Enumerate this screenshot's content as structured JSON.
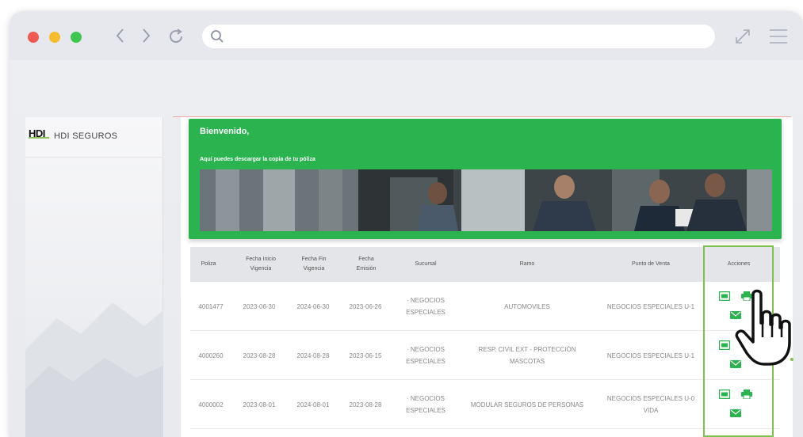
{
  "browser": {
    "address_placeholder": "",
    "address_value": ""
  },
  "sidebar": {
    "logo_mark": "HDI",
    "logo_text": "HDI SEGUROS"
  },
  "banner": {
    "welcome": "Bienvenido,",
    "subtitle": "Aquí puedes descargar la copia de tu póliza"
  },
  "table": {
    "headers": [
      {
        "line1": "Poliza",
        "line2": ""
      },
      {
        "line1": "Fecha Inicio",
        "line2": "Vigencia"
      },
      {
        "line1": "Fecha Fin",
        "line2": "Vigencia"
      },
      {
        "line1": "Fecha",
        "line2": "Emisión"
      },
      {
        "line1": "Sucursal",
        "line2": ""
      },
      {
        "line1": "Ramo",
        "line2": ""
      },
      {
        "line1": "Punto de Venta",
        "line2": ""
      },
      {
        "line1": "Acciones",
        "line2": ""
      }
    ],
    "rows": [
      {
        "poliza": "4001477",
        "inicio": "2023-06-30",
        "fin": "2024-06-30",
        "emision": "2023-06-26",
        "sucursal1": "· NEGOCIOS",
        "sucursal2": "ESPECIALES",
        "ramo1": "AUTOMOVILES",
        "ramo2": "",
        "punto1": "NEGOCIOS ESPECIALES U-1",
        "punto2": ""
      },
      {
        "poliza": "4000260",
        "inicio": "2023-08-28",
        "fin": "2024-08-28",
        "emision": "2023-06-15",
        "sucursal1": "· NEGOCIOS",
        "sucursal2": "ESPECIALES",
        "ramo1": "RESP. CIVIL EXT - PROTECCIÓN",
        "ramo2": "MASCOTAS",
        "punto1": "NEGOCIOS ESPECIALES U-1",
        "punto2": ""
      },
      {
        "poliza": "4000002",
        "inicio": "2023-08-01",
        "fin": "2024-08-01",
        "emision": "2023-08-28",
        "sucursal1": "· NEGOCIOS",
        "sucursal2": "ESPECIALES",
        "ramo1": "MODULAR SEGUROS DE PERSONAS",
        "ramo2": "",
        "punto1": "NEGOCIOS ESPECIALES U-0",
        "punto2": "VIDA"
      }
    ]
  },
  "icons": {
    "view": "pdf-view-icon",
    "print": "print-icon",
    "email": "email-icon"
  },
  "colors": {
    "banner": "#2bb34f",
    "action_icons": "#2bb34f",
    "highlight": "#7dc14f"
  }
}
